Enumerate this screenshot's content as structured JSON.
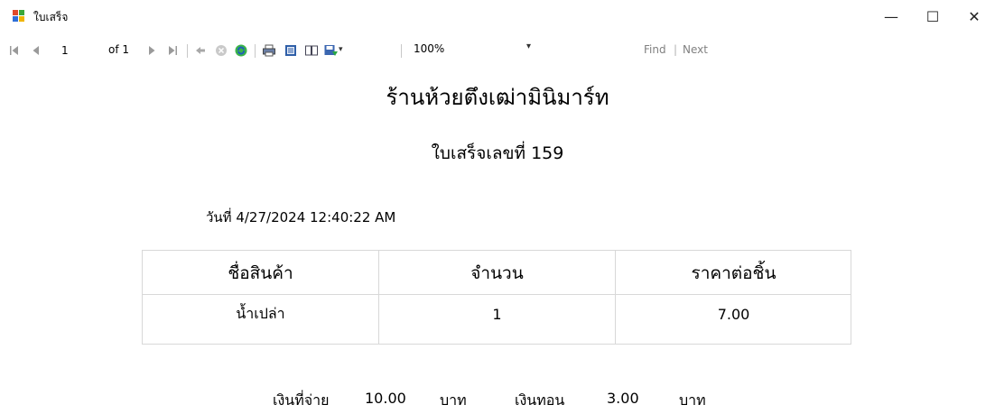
{
  "window": {
    "title": "ใบเสร็จ",
    "controls": {
      "minimize": "—",
      "maximize": "☐",
      "close": "✕"
    }
  },
  "toolbar": {
    "page_current": "1",
    "page_of": "of 1",
    "zoom": "100%",
    "find_label": "Find",
    "separator": "|",
    "next_label": "Next",
    "icons": [
      "first-page-icon",
      "prev-page-icon",
      "next-page-icon",
      "last-page-icon",
      "back-icon",
      "stop-icon",
      "refresh-icon",
      "print-icon",
      "print-layout-icon",
      "page-setup-icon",
      "export-icon"
    ]
  },
  "report": {
    "shop_name": "ร้านห้วยตึงเฒ่ามินิมาร์ท",
    "receipt_number": "ใบเสร็จเลขที่ 159",
    "date": "วันที่ 4/27/2024 12:40:22 AM",
    "table": {
      "headers": [
        "ชื่อสินค้า",
        "จำนวน",
        "ราคาต่อชิ้น"
      ],
      "rows": [
        [
          "น้ำเปล่า",
          "1",
          "7.00"
        ]
      ]
    },
    "summary": {
      "paid_label": "เงินที่จ่าย",
      "paid_value": "10.00",
      "paid_unit": "บาท",
      "change_label": "เงินทอน",
      "change_value": "3.00",
      "change_unit": "บาท"
    }
  },
  "colors": {
    "border": "#d8d8d8",
    "toolbar_text": "#555555"
  }
}
